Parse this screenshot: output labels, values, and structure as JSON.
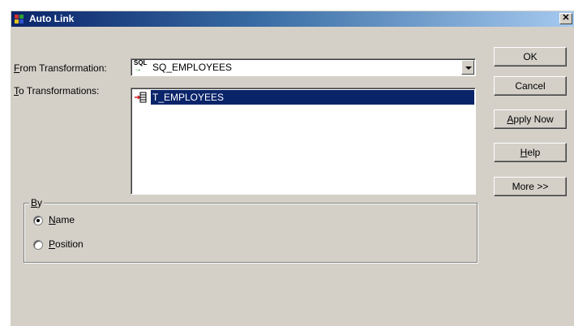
{
  "window": {
    "title": "Auto Link",
    "close_glyph": "✕"
  },
  "form": {
    "from_label_key": "F",
    "from_label_rest": "rom Transformation:",
    "from_value": "SQ_EMPLOYEES",
    "from_icon_text": "SQL",
    "to_label_key": "T",
    "to_label_rest": "o Transformations:",
    "to_items": [
      "T_EMPLOYEES"
    ]
  },
  "buttons": {
    "ok": "OK",
    "cancel": "Cancel",
    "apply_key": "A",
    "apply_rest": "pply Now",
    "help_key": "H",
    "help_rest": "elp",
    "more": "More >>"
  },
  "by_group": {
    "legend_key": "B",
    "legend_rest": "y",
    "name_key": "N",
    "name_rest": "ame",
    "position_key": "P",
    "position_rest": "osition",
    "selected": "Name"
  },
  "colors": {
    "title_start": "#0a246a",
    "title_end": "#a6caf0",
    "selection": "#0a246a",
    "face": "#d4d0c8"
  },
  "icons": [
    "app-icon",
    "sql-source-icon",
    "target-table-icon",
    "close-icon",
    "dropdown-arrow-icon"
  ]
}
